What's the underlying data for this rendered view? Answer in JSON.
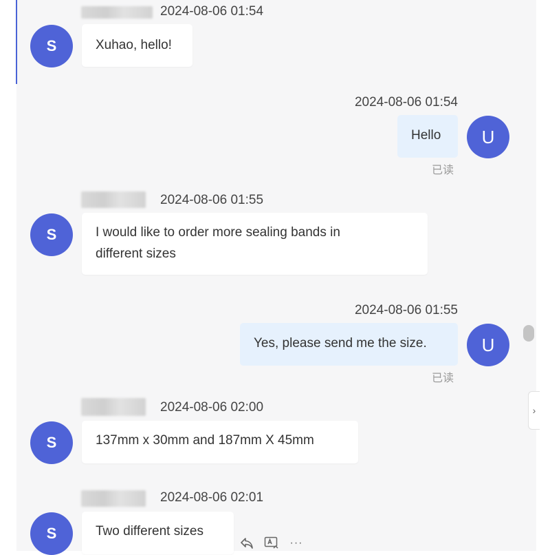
{
  "colors": {
    "avatar": "#4f63d7",
    "incoming_bubble": "#ffffff",
    "outgoing_bubble": "#e6f1fd",
    "chat_background": "#f6f6f7"
  },
  "messages": [
    {
      "sender": "S",
      "direction": "incoming",
      "timestamp": "2024-08-06 01:54",
      "text": "Xuhao, hello!"
    },
    {
      "sender": "U",
      "direction": "outgoing",
      "timestamp": "2024-08-06 01:54",
      "text": "Hello",
      "status": "已读"
    },
    {
      "sender": "S",
      "direction": "incoming",
      "timestamp": "2024-08-06 01:55",
      "text_lines": [
        "I would like to order more sealing bands in",
        "different sizes"
      ]
    },
    {
      "sender": "U",
      "direction": "outgoing",
      "timestamp": "2024-08-06 01:55",
      "text": "Yes, please send me the size.",
      "status": "已读"
    },
    {
      "sender": "S",
      "direction": "incoming",
      "timestamp": "2024-08-06 02:00",
      "text": "137mm x 30mm and 187mm X 45mm"
    },
    {
      "sender": "S",
      "direction": "incoming",
      "timestamp": "2024-08-06 02:01",
      "text": "Two different sizes"
    }
  ],
  "message_actions": {
    "icons": [
      "reply-icon",
      "translate-icon",
      "more-icon"
    ],
    "more_label": "···"
  },
  "side_toggle": {
    "icon": "chevron-right-icon",
    "glyph": "›"
  }
}
